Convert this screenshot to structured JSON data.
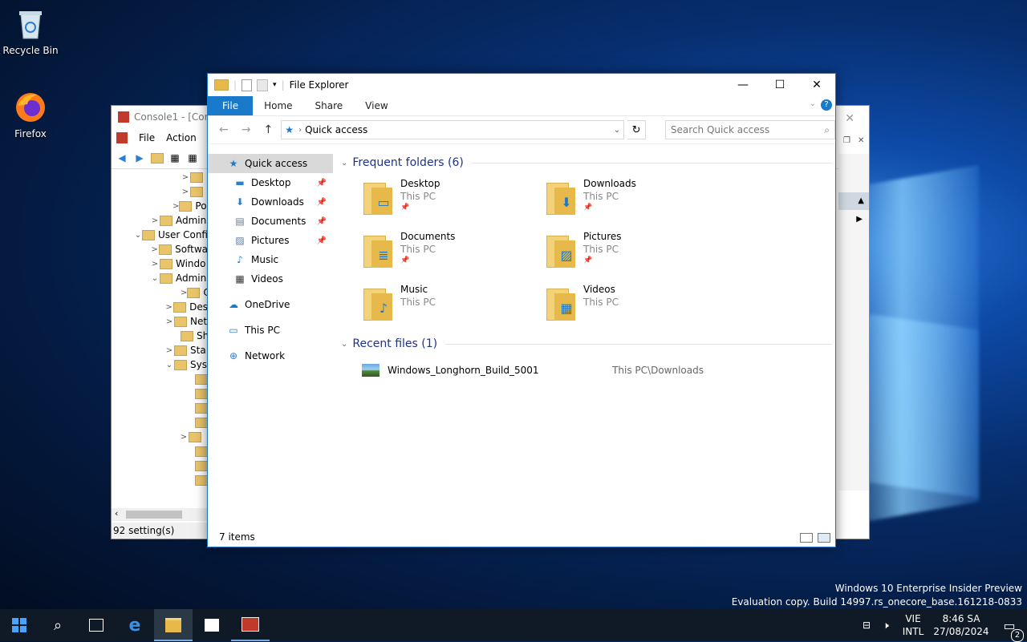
{
  "desktop": {
    "icons": [
      {
        "label": "Recycle Bin"
      },
      {
        "label": "Firefox"
      }
    ]
  },
  "mmc": {
    "title": "Console1 - [Cons",
    "menu": [
      "File",
      "Action",
      "Vi"
    ],
    "tree": [
      {
        "label": "",
        "chevron": ">"
      },
      {
        "label": "",
        "chevron": ">"
      },
      {
        "label": "Pol",
        "chevron": ">"
      },
      {
        "label": "Admin",
        "chevron": ">"
      },
      {
        "label": "User Confi",
        "chevron": "v"
      },
      {
        "label": "Softwa",
        "chevron": ">"
      },
      {
        "label": "Windo",
        "chevron": ">"
      },
      {
        "label": "Admin",
        "chevron": "v"
      },
      {
        "label": "Cor",
        "chevron": ">"
      },
      {
        "label": "Des",
        "chevron": ">"
      },
      {
        "label": "Net",
        "chevron": ">"
      },
      {
        "label": "Sha",
        "chevron": ""
      },
      {
        "label": "Sta",
        "chevron": ">"
      },
      {
        "label": "Sys",
        "chevron": "v"
      },
      {
        "label": "",
        "chevron": ""
      },
      {
        "label": "",
        "chevron": ""
      },
      {
        "label": "",
        "chevron": ""
      },
      {
        "label": "",
        "chevron": ""
      },
      {
        "label": "",
        "chevron": ">"
      },
      {
        "label": "",
        "chevron": ""
      },
      {
        "label": "",
        "chevron": ""
      },
      {
        "label": "",
        "chevron": ""
      }
    ],
    "status": "92 setting(s)"
  },
  "explorer": {
    "title": "File Explorer",
    "tabs": {
      "file": "File",
      "home": "Home",
      "share": "Share",
      "view": "View"
    },
    "address": "Quick access",
    "search_placeholder": "Search Quick access",
    "nav": [
      {
        "label": "Quick access",
        "icon": "star-icon",
        "pinned": false,
        "selected": true
      },
      {
        "label": "Desktop",
        "icon": "desktop-icon",
        "pinned": true
      },
      {
        "label": "Downloads",
        "icon": "download-icon",
        "pinned": true
      },
      {
        "label": "Documents",
        "icon": "document-icon",
        "pinned": true
      },
      {
        "label": "Pictures",
        "icon": "pictures-icon",
        "pinned": true
      },
      {
        "label": "Music",
        "icon": "music-icon",
        "pinned": false
      },
      {
        "label": "Videos",
        "icon": "video-icon",
        "pinned": false
      },
      {
        "label": "OneDrive",
        "icon": "cloud-icon",
        "pinned": false
      },
      {
        "label": "This PC",
        "icon": "computer-icon",
        "pinned": false
      },
      {
        "label": "Network",
        "icon": "network-icon",
        "pinned": false
      }
    ],
    "frequent_header": "Frequent folders (6)",
    "folders": [
      {
        "name": "Desktop",
        "location": "This PC",
        "overlay": "▭"
      },
      {
        "name": "Downloads",
        "location": "This PC",
        "overlay": "⬇"
      },
      {
        "name": "Documents",
        "location": "This PC",
        "overlay": "≣"
      },
      {
        "name": "Pictures",
        "location": "This PC",
        "overlay": "▨"
      },
      {
        "name": "Music",
        "location": "This PC",
        "overlay": "♪"
      },
      {
        "name": "Videos",
        "location": "This PC",
        "overlay": "▦"
      }
    ],
    "recent_header": "Recent files (1)",
    "recent": [
      {
        "name": "Windows_Longhorn_Build_5001",
        "path": "This PC\\Downloads"
      }
    ],
    "status": "7 items"
  },
  "watermark": {
    "line1": "Windows 10 Enterprise Insider Preview",
    "line2": "Evaluation copy. Build 14997.rs_onecore_base.161218-0833"
  },
  "taskbar": {
    "lang_top": "VIE",
    "lang_bottom": "INTL",
    "time": "8:46 SA",
    "date": "27/08/2024",
    "notifications": "2"
  },
  "colors": {
    "accent": "#1979ca",
    "taskbar": "#101a26",
    "folder": "#e7b84a"
  }
}
